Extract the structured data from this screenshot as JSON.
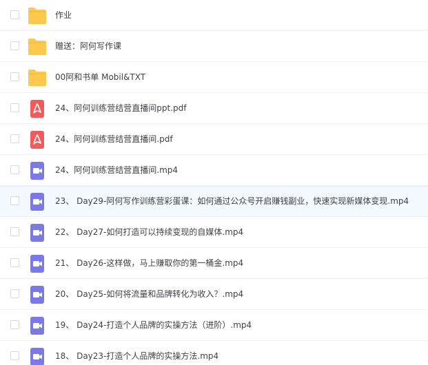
{
  "files": [
    {
      "name": "作业",
      "icon": "folder-icon"
    },
    {
      "name": "赠送：阿何写作课",
      "icon": "folder-icon"
    },
    {
      "name": "00阿和书单 Mobil&TXT",
      "icon": "folder-icon"
    },
    {
      "name": "24、阿何训练营结营直播间ppt.pdf",
      "icon": "pdf-icon"
    },
    {
      "name": "24、阿何训练营结营直播间.pdf",
      "icon": "pdf-icon"
    },
    {
      "name": "24、阿何训练营结营直播间.mp4",
      "icon": "video-icon"
    },
    {
      "name": "23、 Day29-阿何写作训练营彩蛋课：如何通过公众号开启赚钱副业，快速实现新媒体变现.mp4",
      "icon": "video-icon"
    },
    {
      "name": "22、 Day27-如何打造可以持续变现的自媒体.mp4",
      "icon": "video-icon"
    },
    {
      "name": "21、 Day26-这样做，马上赚取你的第一桶金.mp4",
      "icon": "video-icon"
    },
    {
      "name": "20、 Day25-如何将流量和品牌转化为收入？.mp4",
      "icon": "video-icon"
    },
    {
      "name": "19、 Day24-打造个人品牌的实操方法（进阶）.mp4",
      "icon": "video-icon"
    },
    {
      "name": "18、 Day23-打造个人品牌的实操方法.mp4",
      "icon": "video-icon"
    }
  ],
  "colors": {
    "folder": "#fcc94a",
    "pdf": "#f15b5b",
    "video": "#7a79e6"
  }
}
